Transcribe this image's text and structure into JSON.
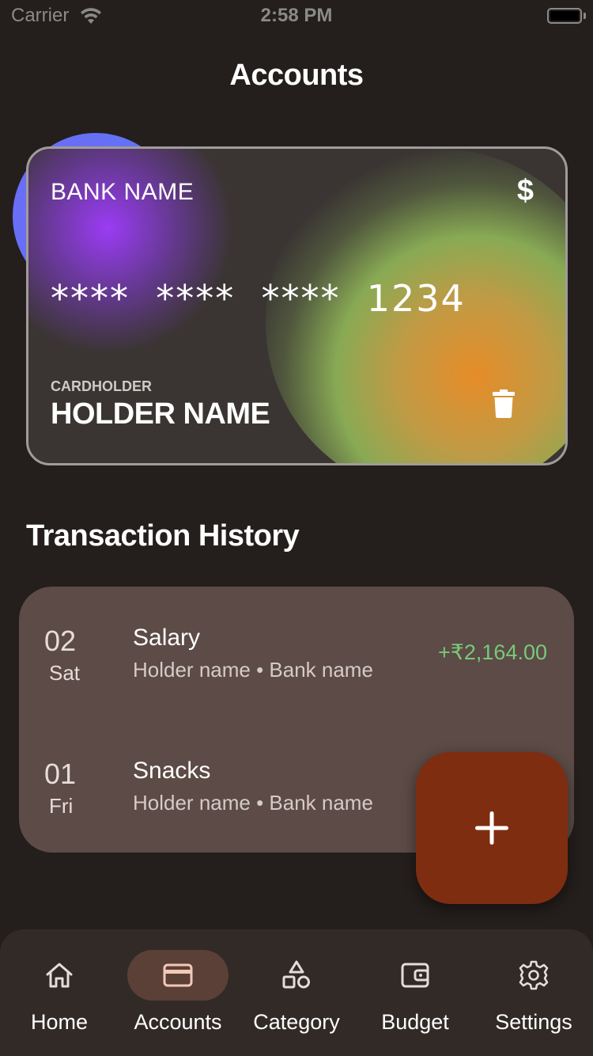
{
  "status_bar": {
    "carrier": "Carrier",
    "time": "2:58 PM"
  },
  "header": {
    "title": "Accounts"
  },
  "card": {
    "bank_name": "BANK NAME",
    "currency_symbol": "$",
    "number": "****  ****  ****  1234",
    "cardholder_label": "CARDHOLDER",
    "holder_name": "HOLDER NAME",
    "delete_icon": "trash-icon"
  },
  "transactions": {
    "title": "Transaction History",
    "items": [
      {
        "day": "02",
        "weekday": "Sat",
        "title": "Salary",
        "subtitle": "Holder name • Bank name",
        "amount": "+₹2,164.00"
      },
      {
        "day": "01",
        "weekday": "Fri",
        "title": "Snacks",
        "subtitle": "Holder name • Bank name",
        "amount": ""
      }
    ]
  },
  "fab": {
    "icon": "plus-icon"
  },
  "nav": {
    "items": [
      {
        "label": "Home",
        "icon": "home-icon",
        "active": false
      },
      {
        "label": "Accounts",
        "icon": "credit-card-icon",
        "active": true
      },
      {
        "label": "Category",
        "icon": "shapes-icon",
        "active": false
      },
      {
        "label": "Budget",
        "icon": "wallet-icon",
        "active": false
      },
      {
        "label": "Settings",
        "icon": "gear-icon",
        "active": false
      }
    ]
  },
  "colors": {
    "background": "#241e1c",
    "panel": "#5c4b46",
    "fab": "#7f2d10",
    "income": "#79c979",
    "nav_active_pill": "#5a4037"
  }
}
